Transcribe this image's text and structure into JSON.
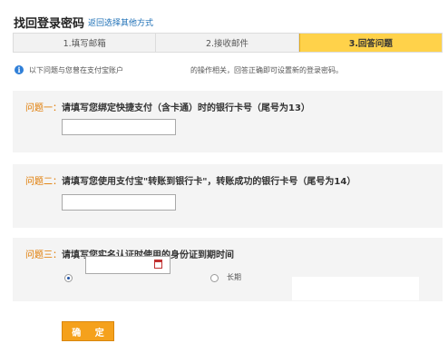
{
  "header": {
    "title": "找回登录密码",
    "switch_link": "返回选择其他方式"
  },
  "steps": [
    {
      "label": "1.填写邮箱",
      "active": false
    },
    {
      "label": "2.接收邮件",
      "active": false
    },
    {
      "label": "3.回答问题",
      "active": true
    }
  ],
  "info": {
    "icon": "info-icon",
    "text_part1": "以下问题与您曾在支付宝账户",
    "text_part2": "的操作相关，回答正确即可设置新的登录密码。"
  },
  "questions": [
    {
      "number": "问题一：",
      "text": "请填写您绑定快捷支付（含卡通）时的银行卡号（尾号为13）",
      "answer_value": ""
    },
    {
      "number": "问题二：",
      "text": "请填写您使用支付宝\"转账到银行卡\"，转账成功的银行卡号（尾号为14）",
      "answer_value": ""
    },
    {
      "number": "问题三：",
      "text": "请填写您实名认证时使用的身份证到期时间",
      "date_value": "",
      "date_selected": true,
      "long_term_label": "长期",
      "long_term_selected": false
    }
  ],
  "confirm_label": "确 定",
  "colors": {
    "accent_orange": "#f5a11c",
    "step_active": "#ffd24a",
    "question_number": "#e07a00",
    "link_blue": "#1c6fb6"
  }
}
